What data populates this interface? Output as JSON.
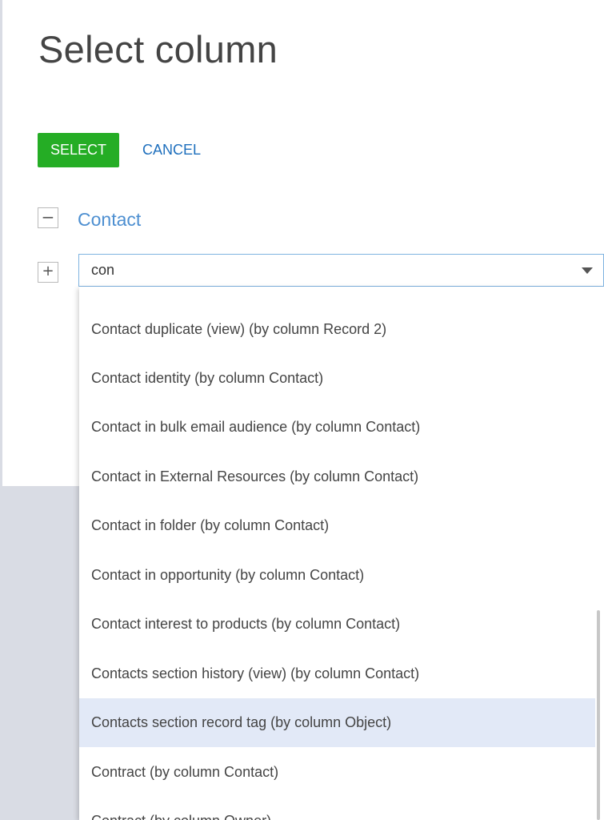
{
  "dialog": {
    "title": "Select column",
    "select_label": "SELECT",
    "cancel_label": "CANCEL"
  },
  "group": {
    "collapse_symbol": "−",
    "label": "Contact",
    "add_symbol": "+"
  },
  "search": {
    "value": "con"
  },
  "dropdown": {
    "items": [
      "Contact duplicate (view) (by column Record 2)",
      "Contact identity (by column Contact)",
      "Contact in bulk email audience (by column Contact)",
      "Contact in External Resources (by column Contact)",
      "Contact in folder (by column Contact)",
      "Contact in opportunity (by column Contact)",
      "Contact interest to products (by column Contact)",
      "Contacts section history (view) (by column Contact)",
      "Contacts section record tag (by column Object)",
      "Contract (by column Contact)",
      "Contract (by column Owner)"
    ],
    "selected_index": 8
  },
  "colors": {
    "primary_button": "#25ad25",
    "link": "#1e6fbd",
    "group_label": "#4d8fd1",
    "selected_row": "#e2e9f7"
  }
}
